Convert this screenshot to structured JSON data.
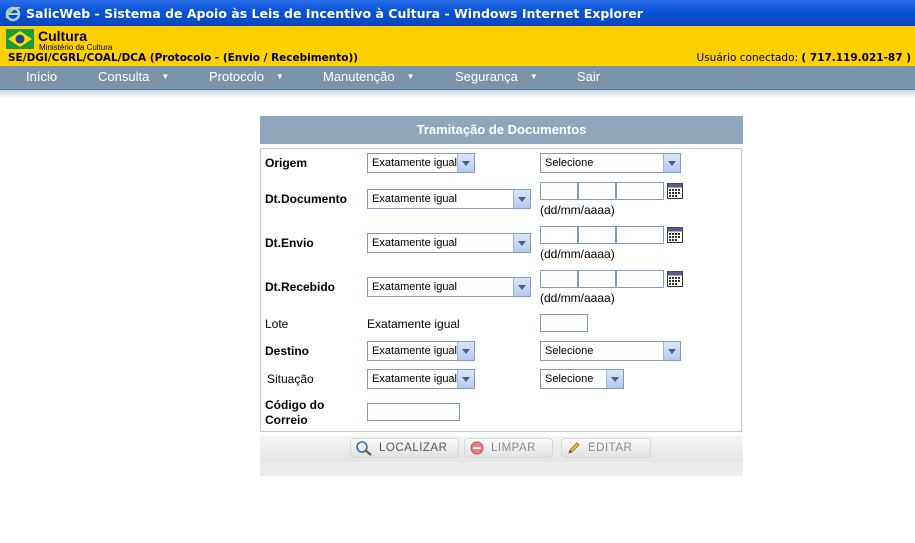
{
  "window": {
    "title": "SalicWeb - Sistema de Apoio às Leis de Incentivo à Cultura - Windows Internet Explorer"
  },
  "header": {
    "brand": "Cultura",
    "ministry": "Ministério da Cultura",
    "breadcrumb": "SE/DGI/CGRL/COAL/DCA (Protocolo - (Envio / Recebimento))",
    "user_label": "Usuário conectado:",
    "user_value": "( 717.119.021-87 )"
  },
  "menu": {
    "items": [
      {
        "label": "Início"
      },
      {
        "label": "Consulta"
      },
      {
        "label": "Protocolo"
      },
      {
        "label": "Manutenção"
      },
      {
        "label": "Segurança"
      },
      {
        "label": "Sair"
      }
    ]
  },
  "form": {
    "title": "Tramitação de Documentos",
    "origem": {
      "label": "Origem",
      "operator": "Exatamente igual",
      "value": "Selecione"
    },
    "dt_documento": {
      "label": "Dt.Documento",
      "operator": "Exatamente igual",
      "hint": "(dd/mm/aaaa)"
    },
    "dt_envio": {
      "label": "Dt.Envio",
      "operator": "Exatamente igual",
      "hint": "(dd/mm/aaaa)"
    },
    "dt_recebido": {
      "label": "Dt.Recebido",
      "operator": "Exatamente igual",
      "hint": "(dd/mm/aaaa)"
    },
    "lote": {
      "label": "Lote",
      "operator": "Exatamente igual"
    },
    "destino": {
      "label": "Destino",
      "operator": "Exatamente igual",
      "value": "Selecione"
    },
    "situacao": {
      "label": "Situação",
      "operator": "Exatamente igual",
      "value": "Selecione"
    },
    "codigo": {
      "label_line1": "Código do",
      "label_line2": "Correio"
    }
  },
  "buttons": {
    "localizar": "LOCALIZAR",
    "limpar": "LIMPAR",
    "editar": "EDITAR"
  },
  "colors": {
    "titlebar": "#0a55d8",
    "header": "#ffd000",
    "menubar": "#7a94aa",
    "panel_title": "#8ea7bd"
  }
}
